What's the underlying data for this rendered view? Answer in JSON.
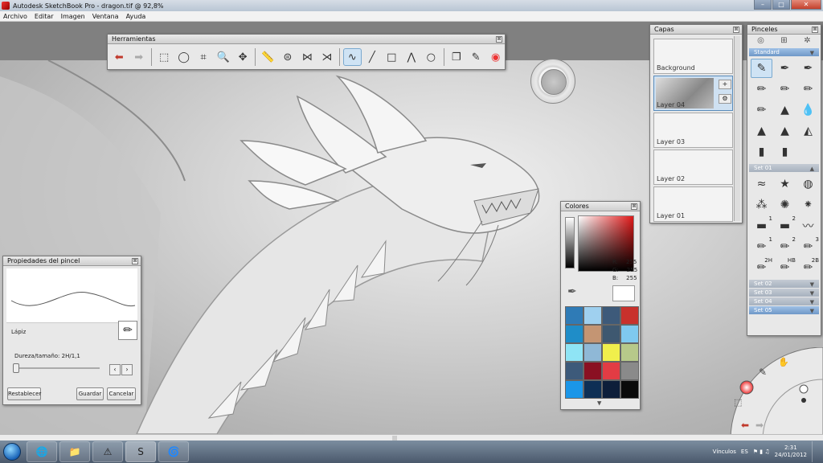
{
  "window": {
    "title": "Autodesk SketchBook Pro - dragon.tif @ 92,8%",
    "minimize": "–",
    "maximize": "□",
    "close": "✕"
  },
  "menu": {
    "items": [
      "Archivo",
      "Editar",
      "Imagen",
      "Ventana",
      "Ayuda"
    ]
  },
  "toolbar": {
    "title": "Herramientas",
    "close": "⊠",
    "tools": [
      {
        "name": "undo-icon",
        "glyph": "⬅"
      },
      {
        "name": "redo-icon",
        "glyph": "➡"
      },
      {
        "name": "rect-select-icon",
        "glyph": "⬚"
      },
      {
        "name": "lasso-icon",
        "glyph": "◯"
      },
      {
        "name": "crop-icon",
        "glyph": "⌗"
      },
      {
        "name": "zoom-icon",
        "glyph": "🔍"
      },
      {
        "name": "move-icon",
        "glyph": "✥"
      },
      {
        "name": "ruler-icon",
        "glyph": "📏"
      },
      {
        "name": "ellipse-guide-icon",
        "glyph": "⊜"
      },
      {
        "name": "symmetry-x-icon",
        "glyph": "⋈"
      },
      {
        "name": "symmetry-y-icon",
        "glyph": "⋊"
      },
      {
        "name": "curve-icon",
        "glyph": "∿"
      },
      {
        "name": "line-icon",
        "glyph": "╱"
      },
      {
        "name": "rectangle-icon",
        "glyph": "□"
      },
      {
        "name": "polyline-icon",
        "glyph": "⋀"
      },
      {
        "name": "circle-icon",
        "glyph": "○"
      },
      {
        "name": "copy-paste-icon",
        "glyph": "❐"
      },
      {
        "name": "brushes-icon",
        "glyph": "✎"
      },
      {
        "name": "color-wheel-icon",
        "glyph": "◉"
      }
    ]
  },
  "puck": {
    "label": "Propiedades del pincel"
  },
  "layers": {
    "title": "Capas",
    "close": "⊠",
    "items": [
      {
        "label": "Background"
      },
      {
        "label": "Layer 04"
      },
      {
        "label": "Layer 03"
      },
      {
        "label": "Layer 02"
      },
      {
        "label": "Layer 01"
      }
    ],
    "add_glyph": "+",
    "menu_glyph": "⚙"
  },
  "brushes": {
    "title": "Pinceles",
    "close": "⊠",
    "tabs": [
      "◎",
      "⊞",
      "✲"
    ],
    "sets": [
      {
        "label": "Standard",
        "active": true
      },
      {
        "label": "Set 01"
      },
      {
        "label": "Set 02"
      },
      {
        "label": "Set 03"
      },
      {
        "label": "Set 04"
      },
      {
        "label": "Set 05",
        "active": true
      }
    ],
    "standard_tools": [
      "✎",
      "✒",
      "✒",
      "✏",
      "✏",
      "✏",
      "✏",
      "▲",
      "💧",
      "▲",
      "▲",
      "◭",
      "▮",
      "▮"
    ],
    "set01_tools": [
      "≈",
      "★",
      "◍",
      "⁂",
      "✺",
      "⁕",
      "▬",
      "▬",
      "〰",
      "✏",
      "✏",
      "✏",
      "✏",
      "✏",
      "✏"
    ],
    "set01_tags": [
      "",
      "",
      "",
      "",
      "",
      "",
      "1",
      "2",
      "",
      "1",
      "2",
      "3",
      "2H",
      "HB",
      "2B"
    ],
    "set_arrow": "▼"
  },
  "colors": {
    "title": "Colores",
    "close": "⊠",
    "r_label": "R:",
    "r_value": "255",
    "g_label": "G:",
    "g_value": "255",
    "b_label": "B:",
    "b_value": "255",
    "up": "▲",
    "down": "▲",
    "swatches": [
      "#2f7bb6",
      "#9fd0ef",
      "#3d5a7a",
      "#c8312c",
      "#1f8dc8",
      "#c49573",
      "#3e5870",
      "#7fc9ef",
      "#8fe4f5",
      "#8fb8d6",
      "#f0ef4c",
      "#b7c98a",
      "#3d5a7a",
      "#8a1022",
      "#e23c44",
      "#8a8a8a",
      "#1b96e8",
      "#0e2f55",
      "#0d1e3a",
      "#0a0a0a"
    ]
  },
  "brush_props": {
    "title": "Propiedades del pincel",
    "close": "⊠",
    "brush_name": "Lápiz",
    "hardness": "Dureza/tamaño: 2H/1,1",
    "minus": "‹",
    "plus": "›",
    "reset": "Restablecer",
    "save": "Guardar",
    "cancel": "Cancelar"
  },
  "taskbar": {
    "apps": [
      "🌐",
      "📁",
      "⚠",
      "S",
      "🌀"
    ],
    "links": "Vínculos",
    "lang": "ES",
    "time": "2:31",
    "date": "24/01/2012"
  },
  "scrollbar": {
    "grip": "|||"
  }
}
